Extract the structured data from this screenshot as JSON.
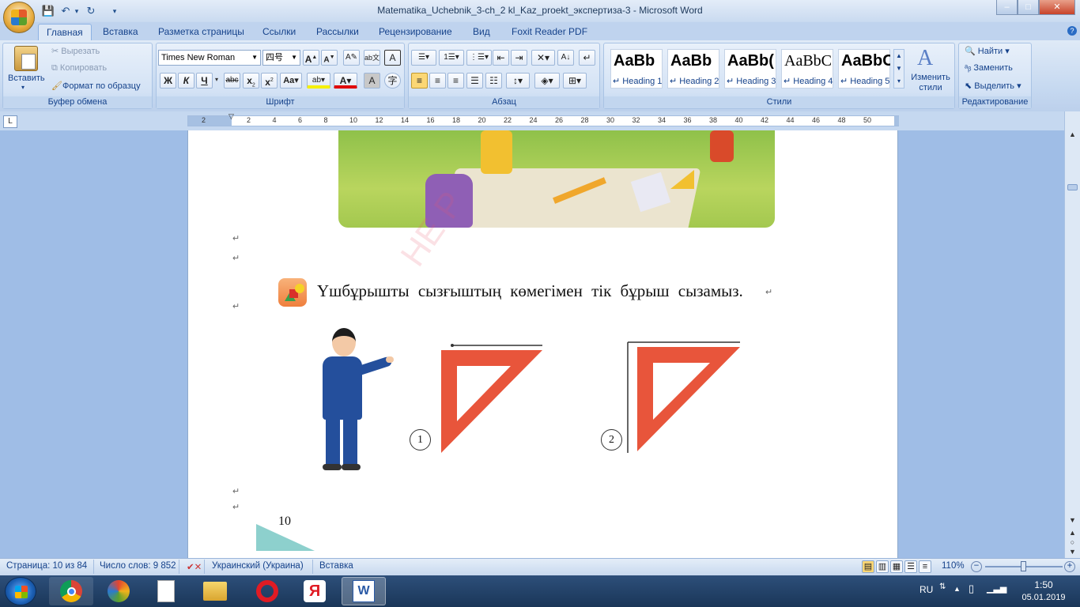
{
  "window": {
    "title": "Matematika_Uchebnik_3-ch_2 kl_Kaz_proekt_экспертиза-3 - Microsoft Word",
    "help": "?",
    "min": "–",
    "max": "□",
    "close": "✕"
  },
  "tabs": [
    "Главная",
    "Вставка",
    "Разметка страницы",
    "Ссылки",
    "Рассылки",
    "Рецензирование",
    "Вид",
    "Foxit Reader PDF"
  ],
  "clipboard": {
    "paste": "Вставить",
    "cut": "Вырезать",
    "copy": "Копировать",
    "format_painter": "Формат по образцу",
    "label": "Буфер обмена"
  },
  "font": {
    "name": "Times New Roman",
    "size": "四号",
    "label": "Шрифт"
  },
  "paragraph": {
    "label": "Абзац"
  },
  "styles": {
    "items": [
      {
        "preview": "AaBb",
        "label": "↵ Heading 1"
      },
      {
        "preview": "AaBb",
        "label": "↵ Heading 2"
      },
      {
        "preview": "AaBb(",
        "label": "↵ Heading 3"
      },
      {
        "preview": "AaBbC",
        "label": "↵ Heading 4"
      },
      {
        "preview": "AaBbC",
        "label": "↵ Heading 5"
      }
    ],
    "change": "Изменить стили",
    "label": "Стили"
  },
  "editing": {
    "find": "Найти",
    "replace": "Заменить",
    "select": "Выделить",
    "label": "Редактирование"
  },
  "ruler": {
    "ticks": [
      "2",
      "2",
      "4",
      "6",
      "8",
      "10",
      "12",
      "14",
      "16",
      "18",
      "20",
      "22",
      "24",
      "26",
      "28",
      "30",
      "32",
      "34",
      "36",
      "38",
      "40",
      "42",
      "44",
      "46",
      "48",
      "50"
    ]
  },
  "document": {
    "instruction": "Үшбұрышты сызғыштың көмегімен тік бұрыш сызамыз.",
    "label1": "1",
    "label2": "2",
    "page_number": "10",
    "watermark": "НЕ Р",
    "pilcrow": "↵"
  },
  "status": {
    "page": "Страница: 10 из 84",
    "words": "Число слов: 9 852",
    "language": "Украинский (Украина)",
    "mode": "Вставка",
    "zoom": "110%"
  },
  "taskbar": {
    "lang": "RU",
    "time": "1:50",
    "date": "05.01.2019"
  },
  "colors": {
    "triangle": "#e8553b",
    "accent": "#15428b",
    "ribbon": "#dfeaf7"
  }
}
